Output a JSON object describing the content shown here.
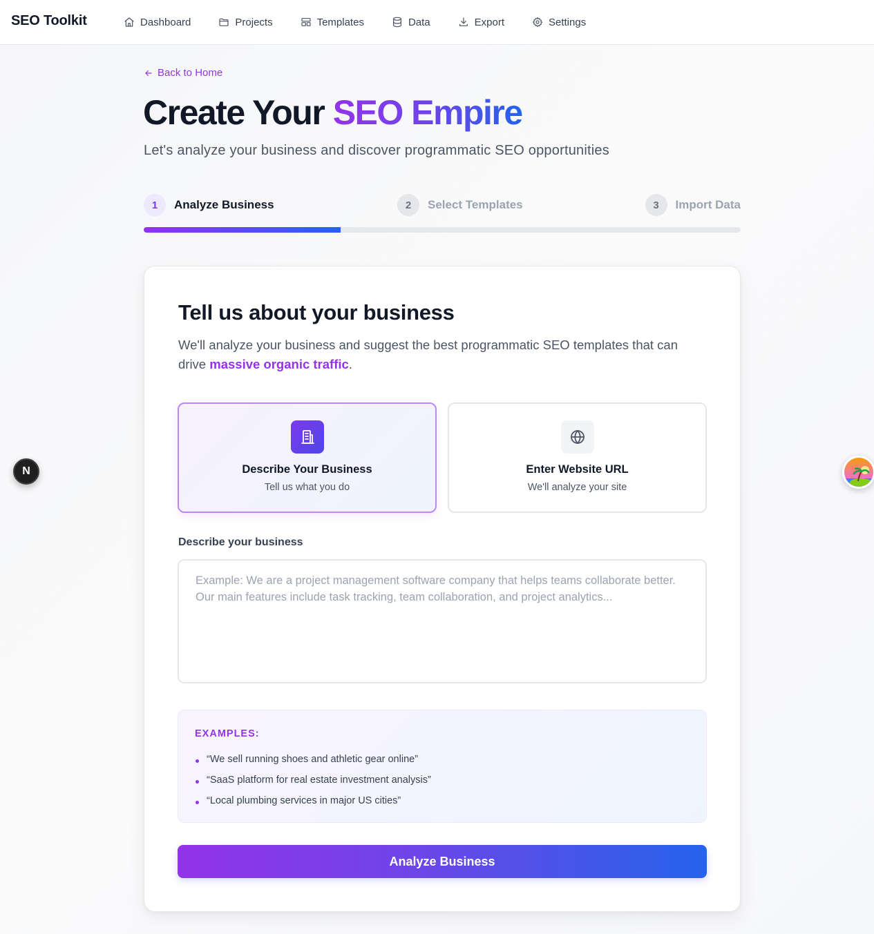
{
  "nav": {
    "brand": "SEO Toolkit",
    "items": [
      {
        "label": "Dashboard",
        "icon": "home-icon"
      },
      {
        "label": "Projects",
        "icon": "folder-icon"
      },
      {
        "label": "Templates",
        "icon": "layout-icon"
      },
      {
        "label": "Data",
        "icon": "database-icon"
      },
      {
        "label": "Export",
        "icon": "download-icon"
      },
      {
        "label": "Settings",
        "icon": "gear-icon"
      }
    ]
  },
  "back_link": "Back to Home",
  "hero": {
    "title_plain": "Create Your ",
    "title_highlight": "SEO Empire",
    "subtitle": "Let's analyze your business and discover programmatic SEO opportunities"
  },
  "steps": [
    {
      "number": "1",
      "label": "Analyze Business",
      "state": "active"
    },
    {
      "number": "2",
      "label": "Select Templates",
      "state": "idle"
    },
    {
      "number": "3",
      "label": "Import Data",
      "state": "idle"
    }
  ],
  "progress_fraction": 0.33,
  "card": {
    "title": "Tell us about your business",
    "desc_before": "We'll analyze your business and suggest the best programmatic SEO templates that can drive ",
    "desc_highlight": "massive organic traffic",
    "desc_after": ".",
    "modes": [
      {
        "title": "Describe Your Business",
        "subtitle": "Tell us what you do",
        "icon": "building-icon",
        "selected": true
      },
      {
        "title": "Enter Website URL",
        "subtitle": "We'll analyze your site",
        "icon": "globe-icon",
        "selected": false
      }
    ],
    "field_label": "Describe your business",
    "field_value": "",
    "field_placeholder": "Example: We are a project management software company that helps teams collaborate better. Our main features include task tracking, team collaboration, and project analytics...",
    "examples_heading": "EXAMPLES:",
    "examples": [
      "“We sell running shoes and athletic gear online”",
      "“SaaS platform for real estate investment analysis”",
      "“Local plumbing services in major US cities”"
    ],
    "cta_label": "Analyze Business"
  },
  "floating": {
    "badge_letter": "N"
  },
  "colors": {
    "accent_purple": "#9333ea",
    "accent_blue": "#2563eb",
    "text_dark": "#111827",
    "muted": "#4b5563"
  }
}
